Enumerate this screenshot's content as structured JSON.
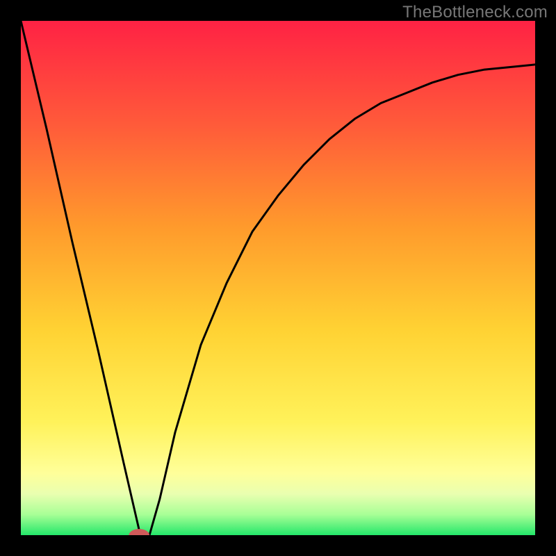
{
  "watermark": "TheBottleneck.com",
  "chart_data": {
    "type": "line",
    "title": "",
    "xlabel": "",
    "ylabel": "",
    "xlim": [
      0,
      100
    ],
    "ylim": [
      0,
      100
    ],
    "series": [
      {
        "name": "curve",
        "x": [
          0,
          5,
          10,
          15,
          20,
          23,
          25,
          27,
          30,
          35,
          40,
          45,
          50,
          55,
          60,
          65,
          70,
          75,
          80,
          85,
          90,
          95,
          100
        ],
        "values": [
          100,
          79,
          57,
          36,
          14,
          1,
          0,
          7,
          20,
          37,
          49,
          59,
          66,
          72,
          77,
          81,
          84,
          86,
          88,
          89.5,
          90.5,
          91,
          91.5
        ]
      }
    ],
    "marker": {
      "x": 23,
      "y": 0,
      "rx": 2.0,
      "ry": 1.2,
      "color": "#d05a5a"
    },
    "background_gradient": {
      "stops": [
        {
          "offset": 0.0,
          "color": "#ff2244"
        },
        {
          "offset": 0.2,
          "color": "#ff5a3a"
        },
        {
          "offset": 0.4,
          "color": "#ff9a2c"
        },
        {
          "offset": 0.6,
          "color": "#ffd233"
        },
        {
          "offset": 0.78,
          "color": "#fff25a"
        },
        {
          "offset": 0.88,
          "color": "#ffff9a"
        },
        {
          "offset": 0.92,
          "color": "#e9ffb0"
        },
        {
          "offset": 0.96,
          "color": "#a8ff96"
        },
        {
          "offset": 1.0,
          "color": "#24e76a"
        }
      ]
    },
    "curve_stroke": "#000000",
    "curve_width": 3
  }
}
